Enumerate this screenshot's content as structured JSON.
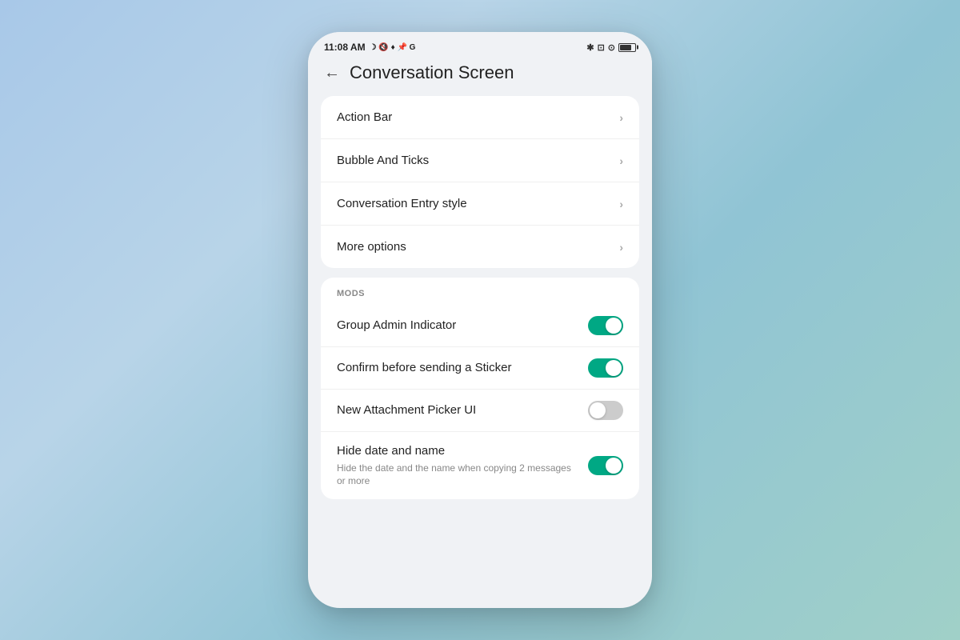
{
  "statusBar": {
    "time": "11:08 AM",
    "icons": "☽ 🔇 ♦ 📌 G",
    "rightIcons": "✱ ⊡ ⊙",
    "battery": "80"
  },
  "header": {
    "backLabel": "←",
    "title": "Conversation Screen"
  },
  "menuCard": {
    "items": [
      {
        "label": "Action Bar"
      },
      {
        "label": "Bubble And Ticks"
      },
      {
        "label": "Conversation Entry style"
      },
      {
        "label": "More options"
      }
    ]
  },
  "modsCard": {
    "sectionLabel": "MODS",
    "items": [
      {
        "label": "Group Admin Indicator",
        "sublabel": "",
        "state": "on"
      },
      {
        "label": "Confirm before sending a Sticker",
        "sublabel": "",
        "state": "on"
      },
      {
        "label": "New Attachment Picker UI",
        "sublabel": "",
        "state": "off"
      },
      {
        "label": "Hide date and name",
        "sublabel": "Hide the date and the name when copying 2 messages or more",
        "state": "on"
      }
    ]
  },
  "chevron": "›"
}
